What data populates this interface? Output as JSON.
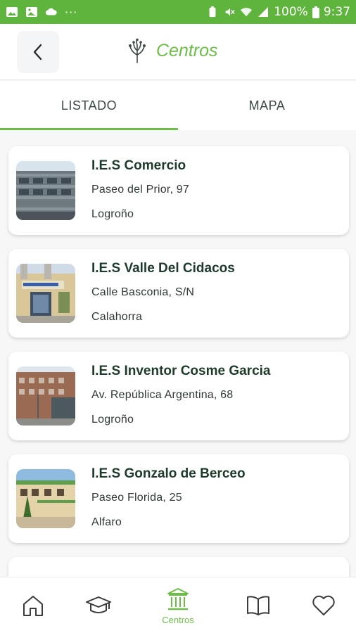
{
  "status_bar": {
    "battery": "100%",
    "time": "9:37",
    "dots": "···"
  },
  "header": {
    "title": "Centros",
    "back_icon": "chevron-left-icon",
    "logo_icon": "sprout-icon"
  },
  "tabs": [
    {
      "label": "LISTADO",
      "active": true
    },
    {
      "label": "MAPA",
      "active": false
    }
  ],
  "centers": [
    {
      "name": "I.E.S Comercio",
      "address": "Paseo del Prior, 97",
      "city": "Logroño"
    },
    {
      "name": "I.E.S Valle Del Cidacos",
      "address": "Calle Basconia, S/N",
      "city": "Calahorra"
    },
    {
      "name": "I.E.S Inventor Cosme Garcia",
      "address": "Av. República Argentina, 68",
      "city": "Logroño"
    },
    {
      "name": "I.E.S Gonzalo de Berceo",
      "address": "Paseo Florida, 25",
      "city": "Alfaro"
    }
  ],
  "bottom_nav": {
    "items": [
      {
        "icon": "home-icon",
        "label": ""
      },
      {
        "icon": "graduation-cap-icon",
        "label": ""
      },
      {
        "icon": "bank-building-icon",
        "label": "Centros",
        "active": true
      },
      {
        "icon": "book-icon",
        "label": ""
      },
      {
        "icon": "heart-icon",
        "label": ""
      }
    ]
  },
  "colors": {
    "accent": "#6bbf46",
    "status_bar": "#5eb43c",
    "text_dark": "#1d3b2a"
  }
}
